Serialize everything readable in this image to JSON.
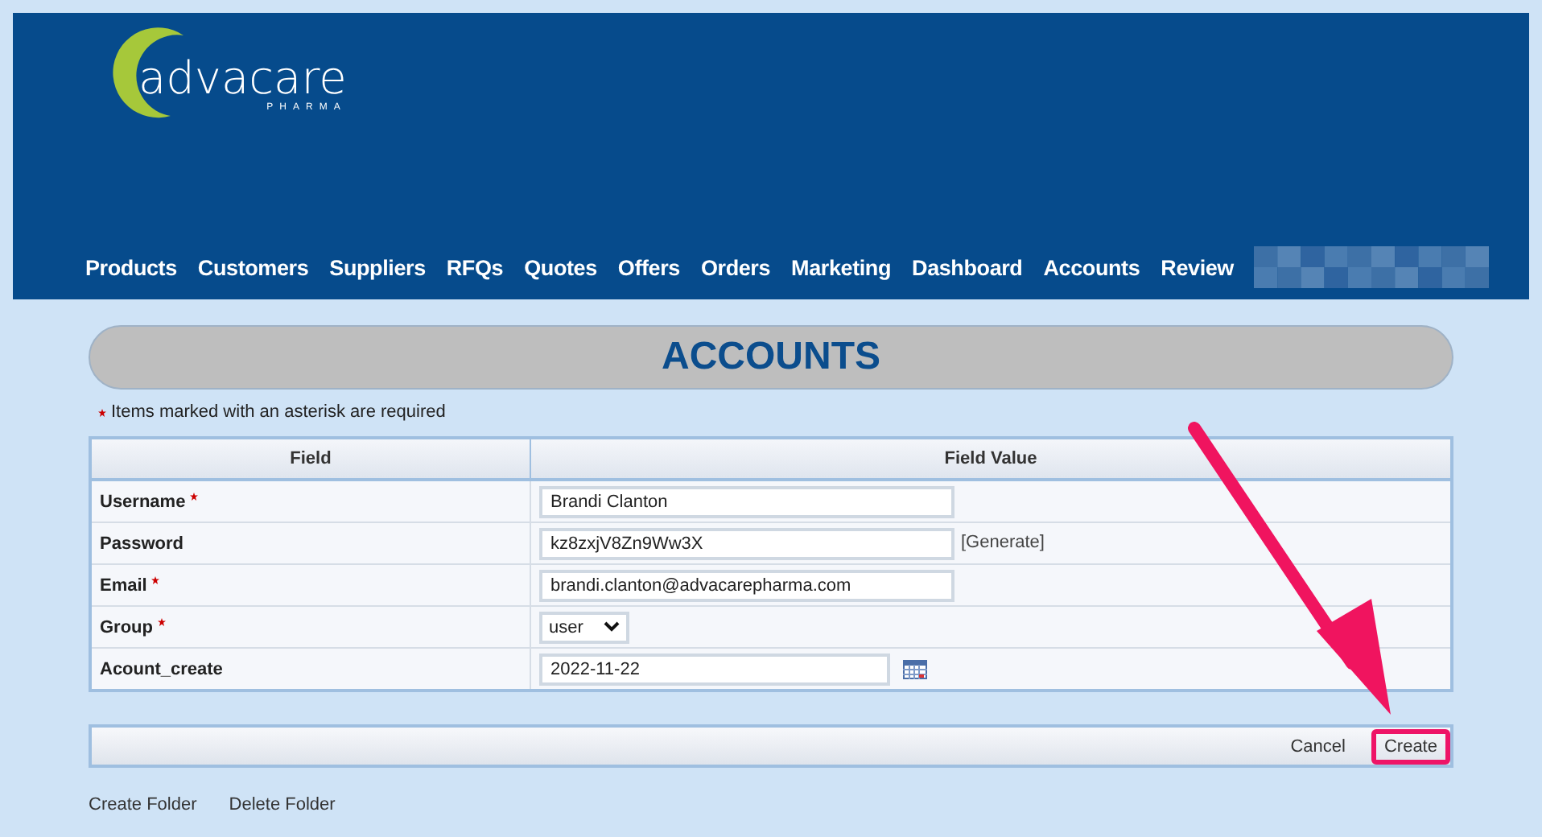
{
  "logo": {
    "name": "advacare",
    "tagline": "PHARMA"
  },
  "nav": {
    "items": [
      {
        "label": "Products"
      },
      {
        "label": "Customers"
      },
      {
        "label": "Suppliers"
      },
      {
        "label": "RFQs"
      },
      {
        "label": "Quotes"
      },
      {
        "label": "Offers"
      },
      {
        "label": "Orders"
      },
      {
        "label": "Marketing"
      },
      {
        "label": "Dashboard"
      },
      {
        "label": "Accounts"
      },
      {
        "label": "Review"
      }
    ],
    "redacted": true
  },
  "page_title": "ACCOUNTS",
  "required_note": "Items marked with an asterisk are required",
  "table": {
    "columns": [
      "Field",
      "Field Value"
    ],
    "rows": [
      {
        "label": "Username",
        "required": true,
        "kind": "text",
        "value": "Brandi Clanton"
      },
      {
        "label": "Password",
        "required": false,
        "kind": "generate",
        "value": "kz8zxjV8Zn9Ww3X",
        "action": "[Generate]"
      },
      {
        "label": "Email",
        "required": true,
        "kind": "text",
        "value": "brandi.clanton@advacarepharma.com"
      },
      {
        "label": "Group",
        "required": true,
        "kind": "select",
        "value": "user"
      },
      {
        "label": "Acount_create",
        "required": false,
        "kind": "date",
        "value": "2022-11-22"
      }
    ]
  },
  "actions": [
    {
      "label": "Cancel",
      "highlighted": false
    },
    {
      "label": "Create",
      "highlighted": true
    }
  ],
  "folder_links": [
    "Create Folder",
    "Delete Folder"
  ],
  "annotation_arrow": true
}
